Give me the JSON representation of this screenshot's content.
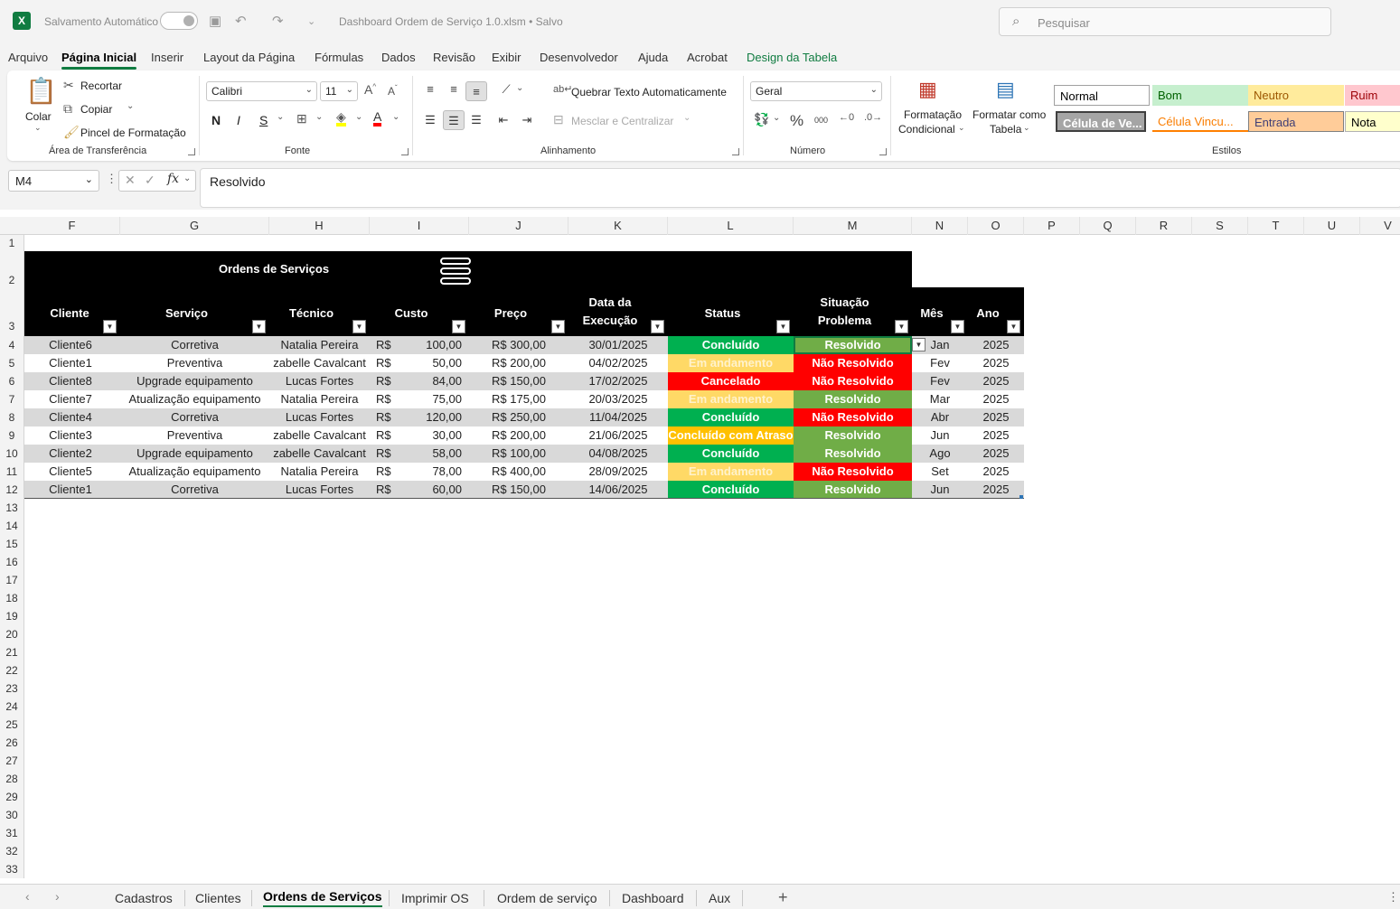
{
  "titlebar": {
    "autosave_label": "Salvamento Automático",
    "file_name": "Dashboard Ordem de Serviço 1.0.xlsm • Salvo",
    "search_placeholder": "Pesquisar",
    "app_icon": "X"
  },
  "menu": [
    "Arquivo",
    "Página Inicial",
    "Inserir",
    "Layout da Página",
    "Fórmulas",
    "Dados",
    "Revisão",
    "Exibir",
    "Desenvolvedor",
    "Ajuda",
    "Acrobat",
    "Design da Tabela"
  ],
  "ribbon": {
    "clipboard": {
      "paste": "Colar",
      "cut": "Recortar",
      "copy": "Copiar",
      "format_painter": "Pincel de Formatação",
      "label": "Área de Transferência"
    },
    "font": {
      "name": "Calibri",
      "size": "11",
      "bold": "N",
      "italic": "I",
      "underline": "S",
      "label": "Fonte"
    },
    "alignment": {
      "wrap": "Quebrar Texto Automaticamente",
      "merge": "Mesclar e Centralizar",
      "label": "Alinhamento"
    },
    "number": {
      "format": "Geral",
      "percent": "%",
      "thousands": "000",
      "label": "Número"
    },
    "conditional": [
      "Formatação",
      "Condicional"
    ],
    "format_table": [
      "Formatar como",
      "Tabela"
    ],
    "styles": {
      "label": "Estilos",
      "items": [
        "Normal",
        "Bom",
        "Neutro",
        "Ruim",
        "Célula de Ve...",
        "Célula Vincu...",
        "Entrada",
        "Nota"
      ]
    }
  },
  "formula_bar": {
    "name_box": "M4",
    "formula": "Resolvido"
  },
  "columns": [
    "F",
    "G",
    "H",
    "I",
    "J",
    "K",
    "L",
    "M",
    "N",
    "O",
    "P",
    "Q",
    "R",
    "S",
    "T",
    "U",
    "V"
  ],
  "rows": [
    "1",
    "2",
    "3",
    "4",
    "5",
    "6",
    "7",
    "8",
    "9",
    "10",
    "11",
    "12",
    "13",
    "14",
    "15",
    "16",
    "17",
    "18",
    "19",
    "20",
    "21",
    "22",
    "23",
    "24",
    "25",
    "26",
    "27",
    "28",
    "29",
    "30",
    "31",
    "32",
    "33"
  ],
  "table": {
    "title": "Ordens de Serviços",
    "headers": [
      "Cliente",
      "Serviço",
      "Técnico",
      "Custo",
      "Preço",
      "Data da Execução",
      "Status",
      "Situação Problema",
      "Mês",
      "Ano"
    ],
    "rows": [
      {
        "cliente": "Cliente6",
        "servico": "Corretiva",
        "tecnico": "Natalia Pereira",
        "custo_sym": "R$",
        "custo": "100,00",
        "preco": "R$ 300,00",
        "data": "30/01/2025",
        "status": "Concluído",
        "situacao": "Resolvido",
        "mes": "Jan",
        "ano": "2025"
      },
      {
        "cliente": "Cliente1",
        "servico": "Preventiva",
        "tecnico": "zabelle Cavalcant",
        "custo_sym": "R$",
        "custo": "50,00",
        "preco": "R$ 200,00",
        "data": "04/02/2025",
        "status": "Em andamento",
        "situacao": "Não Resolvido",
        "mes": "Fev",
        "ano": "2025"
      },
      {
        "cliente": "Cliente8",
        "servico": "Upgrade equipamento",
        "tecnico": "Lucas Fortes",
        "custo_sym": "R$",
        "custo": "84,00",
        "preco": "R$ 150,00",
        "data": "17/02/2025",
        "status": "Cancelado",
        "situacao": "Não Resolvido",
        "mes": "Fev",
        "ano": "2025"
      },
      {
        "cliente": "Cliente7",
        "servico": "Atualização equipamento",
        "tecnico": "Natalia Pereira",
        "custo_sym": "R$",
        "custo": "75,00",
        "preco": "R$ 175,00",
        "data": "20/03/2025",
        "status": "Em andamento",
        "situacao": "Resolvido",
        "mes": "Mar",
        "ano": "2025"
      },
      {
        "cliente": "Cliente4",
        "servico": "Corretiva",
        "tecnico": "Lucas Fortes",
        "custo_sym": "R$",
        "custo": "120,00",
        "preco": "R$ 250,00",
        "data": "11/04/2025",
        "status": "Concluído",
        "situacao": "Não Resolvido",
        "mes": "Abr",
        "ano": "2025"
      },
      {
        "cliente": "Cliente3",
        "servico": "Preventiva",
        "tecnico": "zabelle Cavalcant",
        "custo_sym": "R$",
        "custo": "30,00",
        "preco": "R$ 200,00",
        "data": "21/06/2025",
        "status": "Concluído com Atraso",
        "situacao": "Resolvido",
        "mes": "Jun",
        "ano": "2025"
      },
      {
        "cliente": "Cliente2",
        "servico": "Upgrade equipamento",
        "tecnico": "zabelle Cavalcant",
        "custo_sym": "R$",
        "custo": "58,00",
        "preco": "R$ 100,00",
        "data": "04/08/2025",
        "status": "Concluído",
        "situacao": "Resolvido",
        "mes": "Ago",
        "ano": "2025"
      },
      {
        "cliente": "Cliente5",
        "servico": "Atualização equipamento",
        "tecnico": "Natalia Pereira",
        "custo_sym": "R$",
        "custo": "78,00",
        "preco": "R$ 400,00",
        "data": "28/09/2025",
        "status": "Em andamento",
        "situacao": "Não Resolvido",
        "mes": "Set",
        "ano": "2025"
      },
      {
        "cliente": "Cliente1",
        "servico": "Corretiva",
        "tecnico": "Lucas Fortes",
        "custo_sym": "R$",
        "custo": "60,00",
        "preco": "R$ 150,00",
        "data": "14/06/2025",
        "status": "Concluído",
        "situacao": "Resolvido",
        "mes": "Jun",
        "ano": "2025"
      }
    ]
  },
  "status_colors": {
    "Concluído": "#00b050",
    "Em andamento": "#ffd966",
    "Cancelado": "#ff0000",
    "Concluído com Atraso": "#ffc000",
    "Resolvido": "#70ad47",
    "Não Resolvido": "#ff0000"
  },
  "sheet_tabs": [
    "Cadastros",
    "Clientes",
    "Ordens de Serviços",
    "Imprimir OS",
    "Ordem de serviço",
    "Dashboard",
    "Aux"
  ],
  "active_sheet": "Ordens de Serviços"
}
